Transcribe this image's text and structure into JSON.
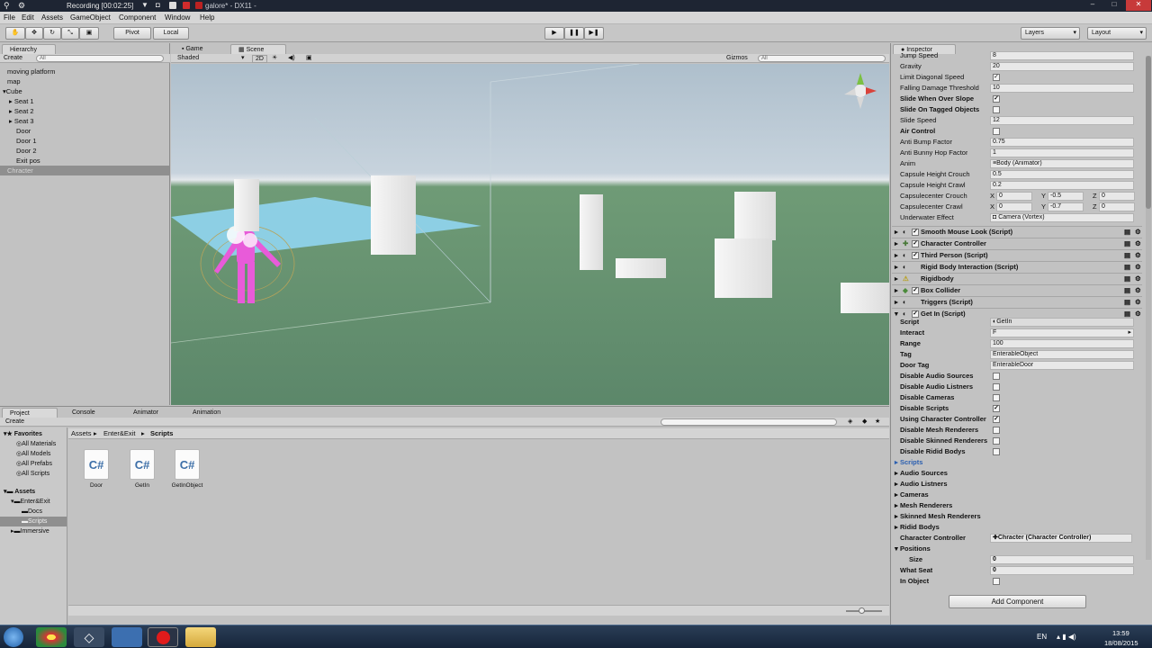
{
  "titlebar": {
    "recording": "Recording [00:02:25]",
    "title": "galore* - DX11 -"
  },
  "menu": [
    "File",
    "Edit",
    "Assets",
    "GameObject",
    "Component",
    "Window",
    "Help"
  ],
  "toolbar": {
    "pivot": "Pivot",
    "local": "Local",
    "layers": "Layers",
    "layout": "Layout"
  },
  "hierarchy": {
    "tab": "Hierarchy",
    "create": "Create",
    "search_placeholder": "All",
    "items": [
      "moving platform",
      "map",
      "Cube",
      "Seat 1",
      "Seat 2",
      "Seat 3",
      "Door",
      "Door 1",
      "Door 2",
      "Exit pos",
      "Chracter"
    ]
  },
  "scene": {
    "tab_game": "Game",
    "tab_scene": "Scene",
    "shading": "Shaded",
    "mode2d": "2D",
    "gizmos": "Gizmos",
    "search_placeholder": "All"
  },
  "project": {
    "tabs": [
      "Project",
      "Console",
      "Animator",
      "Animation"
    ],
    "create": "Create",
    "breadcrumb": [
      "Assets",
      "Enter&Exit",
      "Scripts"
    ],
    "favorites_title": "Favorites",
    "favorites": [
      "All Materials",
      "All Models",
      "All Prefabs",
      "All Scripts"
    ],
    "assets_title": "Assets",
    "assets_tree": [
      "Enter&Exit",
      "Docs",
      "Scripts",
      "Immersive"
    ],
    "files": [
      "Door",
      "GetIn",
      "GetInObject"
    ],
    "file_icon_glyph": "C#"
  },
  "inspector": {
    "tab": "Inspector",
    "top_fields": [
      {
        "label": "Jump Speed",
        "value": "8",
        "bold": false
      },
      {
        "label": "Gravity",
        "value": "20",
        "bold": false
      },
      {
        "label": "Limit Diagonal Speed",
        "check": "✓",
        "bold": false
      },
      {
        "label": "Falling Damage Threshold",
        "value": "10",
        "bold": false
      },
      {
        "label": "Slide When Over Slope",
        "check": "✓",
        "bold": true
      },
      {
        "label": "Slide On Tagged Objects",
        "check": "",
        "bold": true
      },
      {
        "label": "Slide Speed",
        "value": "12",
        "bold": false
      },
      {
        "label": "Air Control",
        "check": "",
        "bold": true
      },
      {
        "label": "Anti Bump Factor",
        "value": "0.75",
        "bold": false
      },
      {
        "label": "Anti Bunny Hop Factor",
        "value": "1",
        "bold": false
      },
      {
        "label": "Anim",
        "value": "Body (Animator)",
        "bold": false
      },
      {
        "label": "Capsule Height Crouch",
        "value": "0.5",
        "bold": false
      },
      {
        "label": "Capsule Height Crawl",
        "value": "0.2",
        "bold": false
      },
      {
        "label": "Capsulecenter Crouch",
        "xyz": [
          "0",
          "-0.5",
          "0"
        ],
        "bold": false
      },
      {
        "label": "Capsulecenter Crawl",
        "xyz": [
          "0",
          "-0.7",
          "0"
        ],
        "bold": false
      },
      {
        "label": "Underwater Effect",
        "value": "Camera (Vortex)",
        "bold": false
      }
    ],
    "components": [
      "Smooth Mouse Look (Script)",
      "Character Controller",
      "Third Person (Script)",
      "Rigid Body Interaction (Script)",
      "Rigidbody",
      "Box Collider",
      "Triggers (Script)",
      "Get In (Script)"
    ],
    "getin_fields": [
      {
        "label": "Script",
        "value": "GetIn"
      },
      {
        "label": "Interact",
        "value": "F"
      },
      {
        "label": "Range",
        "value": "100"
      },
      {
        "label": "Tag",
        "value": "EnterableObject"
      },
      {
        "label": "Door Tag",
        "value": "EnterableDoor"
      },
      {
        "label": "Disable Audio Sources",
        "check": ""
      },
      {
        "label": "Disable Audio Listners",
        "check": ""
      },
      {
        "label": "Disable Cameras",
        "check": ""
      },
      {
        "label": "Disable Scripts",
        "check": "✓"
      },
      {
        "label": "Using Character Controller",
        "check": "✓"
      },
      {
        "label": "Disable Mesh Renderers",
        "check": ""
      },
      {
        "label": "Disable Skinned Renderers",
        "check": ""
      },
      {
        "label": "Disable Ridid Bodys",
        "check": ""
      }
    ],
    "foldouts": [
      "Scripts",
      "Audio Sources",
      "Audio Listners",
      "Cameras",
      "Mesh Renderers",
      "Skinned Mesh Renderers",
      "Ridid Bodys"
    ],
    "character_controller": {
      "label": "Character Controller",
      "value": "Chracter (Character Controller)"
    },
    "positions": {
      "label": "Positions",
      "size_label": "Size",
      "size_value": "0"
    },
    "what_seat": {
      "label": "What Seat",
      "value": "0"
    },
    "in_object": {
      "label": "In Object",
      "check": ""
    },
    "add_component": "Add Component"
  },
  "taskbar": {
    "lang": "EN",
    "time": "13:59",
    "date": "18/08/2015"
  },
  "colors": {
    "scene_sky": "#b9c7d4",
    "scene_ground": "#5f8b6a",
    "water": "#8fd2ea",
    "character": "#e85bd9",
    "accent_blue": "#2b5fb0"
  }
}
